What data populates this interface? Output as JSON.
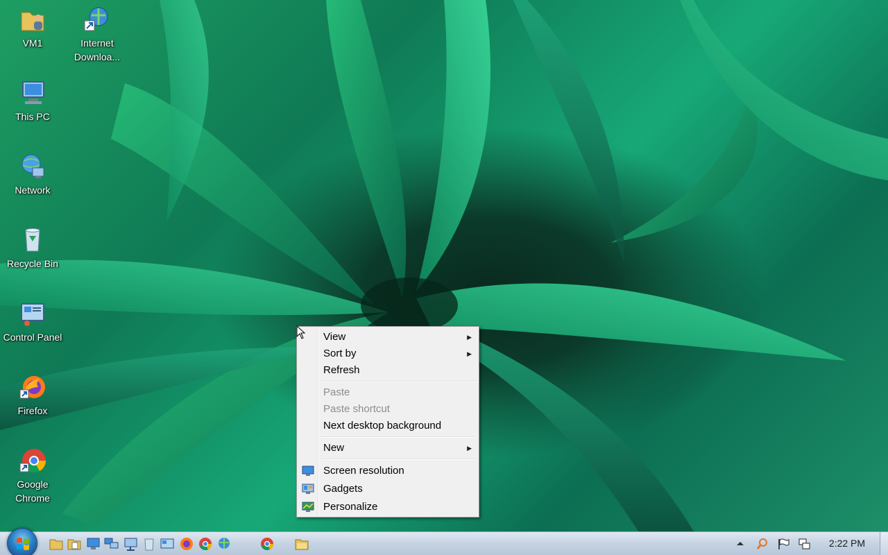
{
  "desktop": {
    "icons": [
      {
        "label": "VM1",
        "icon": "user-folder-icon"
      },
      {
        "label": "Internet Downloa...",
        "icon": "internet-download-manager-icon"
      },
      {
        "label": "This PC",
        "icon": "computer-icon"
      },
      {
        "label": "Network",
        "icon": "network-icon"
      },
      {
        "label": "Recycle Bin",
        "icon": "recycle-bin-icon"
      },
      {
        "label": "Control Panel",
        "icon": "control-panel-icon"
      },
      {
        "label": "Firefox",
        "icon": "firefox-icon"
      },
      {
        "label": "Google Chrome",
        "icon": "chrome-icon"
      }
    ]
  },
  "context_menu": {
    "items": {
      "view": "View",
      "sort_by": "Sort by",
      "refresh": "Refresh",
      "paste": "Paste",
      "paste_shortcut": "Paste shortcut",
      "next_background": "Next desktop background",
      "new": "New",
      "screen_resolution": "Screen resolution",
      "gadgets": "Gadgets",
      "personalize": "Personalize"
    },
    "submenu_arrow": "▶"
  },
  "taskbar": {
    "clock": "2:22 PM",
    "pinned": [
      "file-explorer-icon",
      "documents-icon",
      "computer-icon",
      "network-icon",
      "network-2-icon",
      "recycle-bin-icon",
      "control-panel-icon",
      "firefox-icon",
      "chrome-icon",
      "internet-download-manager-icon"
    ],
    "running": [
      "chrome-icon",
      "file-explorer-icon"
    ]
  },
  "colors": {
    "accent": "#2a7fc4",
    "menu_bg": "#f0f0f0",
    "disabled_text": "#8d8d8d"
  }
}
